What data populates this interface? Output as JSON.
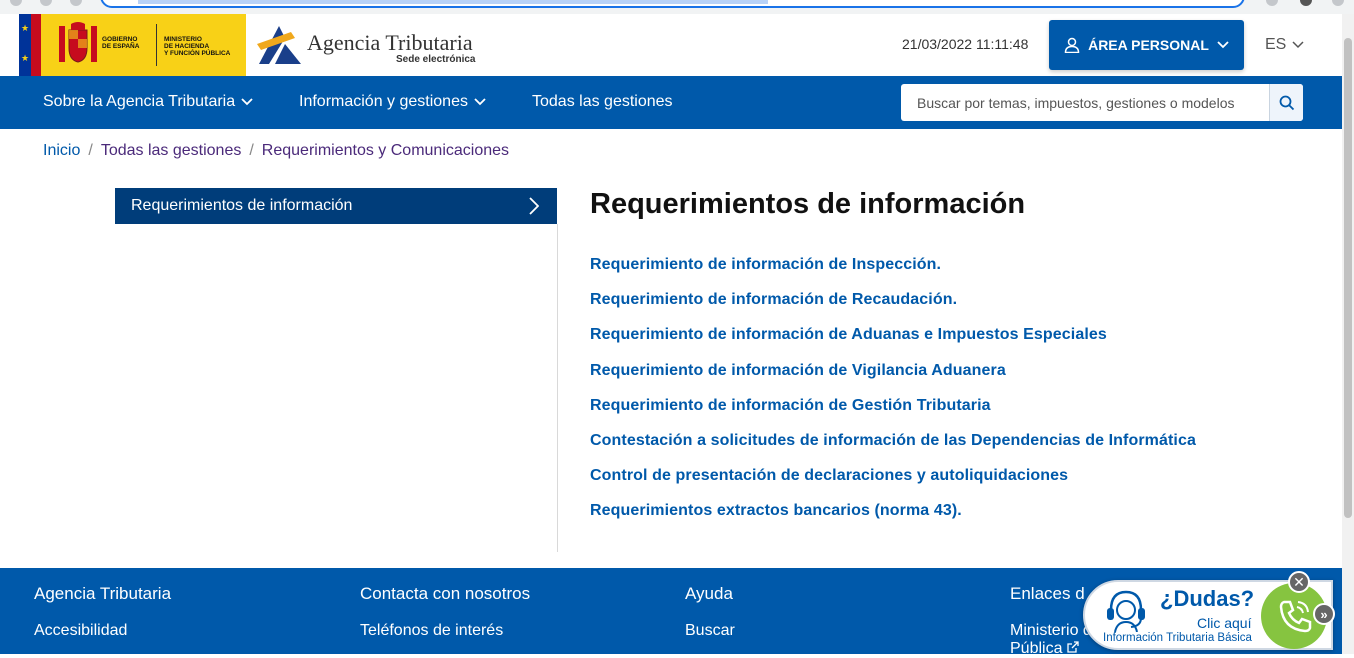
{
  "header": {
    "gov_line1": "GOBIERNO",
    "gov_line2": "DE ESPAÑA",
    "ministry_line1": "MINISTERIO",
    "ministry_line2": "DE HACIENDA",
    "ministry_line3": "Y FUNCIÓN PÚBLICA",
    "agency_name": "Agencia Tributaria",
    "agency_sub": "Sede electrónica",
    "datetime": "21/03/2022 11:11:48",
    "area_personal_label": "ÁREA PERSONAL",
    "language": "ES"
  },
  "nav": {
    "items": [
      {
        "label": "Sobre la Agencia Tributaria",
        "has_dropdown": true
      },
      {
        "label": "Información y gestiones",
        "has_dropdown": true
      },
      {
        "label": "Todas las gestiones",
        "has_dropdown": false
      }
    ],
    "search_placeholder": "Buscar por temas, impuestos, gestiones o modelos"
  },
  "breadcrumb": [
    {
      "label": "Inicio"
    },
    {
      "label": "Todas las gestiones"
    },
    {
      "label": "Requerimientos y Comunicaciones"
    }
  ],
  "sidebar": {
    "active_item": "Requerimientos de información"
  },
  "main": {
    "title": "Requerimientos de información",
    "links": [
      "Requerimiento de información de Inspección.",
      "Requerimiento de información de Recaudación.",
      "Requerimiento de información de Aduanas e Impuestos Especiales",
      "Requerimiento de información de Vigilancia Aduanera",
      "Requerimiento de información de Gestión Tributaria",
      "Contestación a solicitudes de información de las Dependencias de Informática",
      "Control de presentación de declaraciones y autoliquidaciones",
      "Requerimientos extractos bancarios (norma 43)."
    ]
  },
  "footer": {
    "columns": [
      {
        "heading": "Agencia Tributaria",
        "link": "Accesibilidad"
      },
      {
        "heading": "Contacta con nosotros",
        "link": "Teléfonos de interés"
      },
      {
        "heading": "Ayuda",
        "link": "Buscar"
      },
      {
        "heading": "Enlaces d",
        "link": "Ministerio d",
        "link2": "Pública"
      }
    ]
  },
  "dudas_widget": {
    "title": "¿Dudas?",
    "click_label": "Clic aquí",
    "subtitle": "Información Tributaria Básica"
  },
  "colors": {
    "brand_blue": "#0059aa",
    "dark_blue": "#003d7a",
    "gov_yellow": "#f8d117",
    "green": "#86c440"
  },
  "icons": [
    "user-icon",
    "chevron-down-icon",
    "search-icon",
    "chevron-right-icon",
    "external-link-icon",
    "agent-headset-icon",
    "phone-icon",
    "close-icon",
    "double-chevron-right-icon"
  ]
}
